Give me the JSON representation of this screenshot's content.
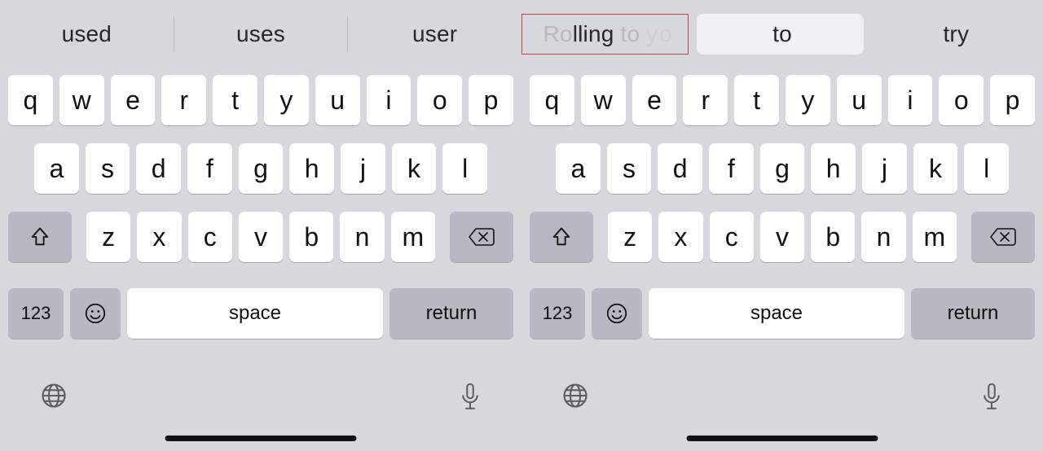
{
  "suggestions_left": {
    "a": "used",
    "b": "uses",
    "c": "user"
  },
  "suggestions_right": {
    "a_prefix": "Ro",
    "a_mid": "lling",
    "a_sfx1": " to ",
    "a_sfx2": "yo",
    "b": "to",
    "c": "try"
  },
  "keys_row1": [
    "q",
    "w",
    "e",
    "r",
    "t",
    "y",
    "u",
    "i",
    "o",
    "p"
  ],
  "keys_row2": [
    "a",
    "s",
    "d",
    "f",
    "g",
    "h",
    "j",
    "k",
    "l"
  ],
  "keys_row3": [
    "z",
    "x",
    "c",
    "v",
    "b",
    "n",
    "m"
  ],
  "labels": {
    "numbers": "123",
    "space": "space",
    "return": "return"
  },
  "colors": {
    "bg": "#d7d8de",
    "key": "#ffffff",
    "func": "#b6b9c3",
    "highlightBorder": "#c74238",
    "pill": "#eef0f3"
  }
}
